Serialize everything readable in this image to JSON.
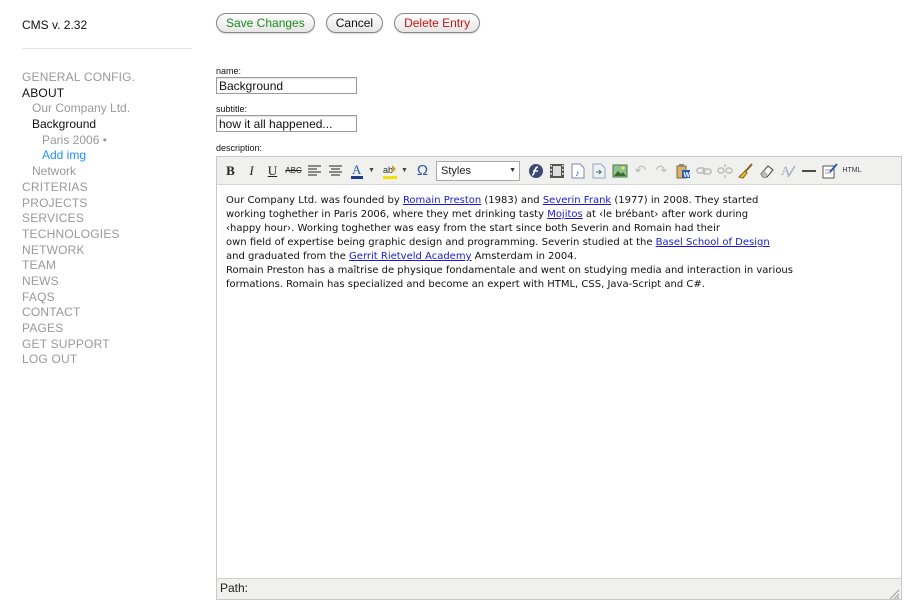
{
  "app": {
    "title": "CMS v. 2.32"
  },
  "nav": {
    "items": [
      {
        "label": "GENERAL CONFIG.",
        "level": 0,
        "active": false,
        "link": false
      },
      {
        "label": "ABOUT",
        "level": 0,
        "active": true,
        "link": false
      },
      {
        "label": "Our Company Ltd.",
        "level": 1,
        "active": false,
        "link": false
      },
      {
        "label": "Background",
        "level": 1,
        "active": true,
        "link": false
      },
      {
        "label": "Paris 2006 •",
        "level": 2,
        "active": false,
        "link": false
      },
      {
        "label": "Add img",
        "level": 2,
        "active": false,
        "link": true
      },
      {
        "label": "Network",
        "level": 1,
        "active": false,
        "link": false
      },
      {
        "label": "CRITERIAS",
        "level": 0,
        "active": false,
        "link": false
      },
      {
        "label": "PROJECTS",
        "level": 0,
        "active": false,
        "link": false
      },
      {
        "label": "SERVICES",
        "level": 0,
        "active": false,
        "link": false
      },
      {
        "label": "TECHNOLOGIES",
        "level": 0,
        "active": false,
        "link": false
      },
      {
        "label": "NETWORK",
        "level": 0,
        "active": false,
        "link": false
      },
      {
        "label": "TEAM",
        "level": 0,
        "active": false,
        "link": false
      },
      {
        "label": "NEWS",
        "level": 0,
        "active": false,
        "link": false
      },
      {
        "label": "FAQS",
        "level": 0,
        "active": false,
        "link": false
      },
      {
        "label": "CONTACT",
        "level": 0,
        "active": false,
        "link": false
      },
      {
        "label": "PAGES",
        "level": 0,
        "active": false,
        "link": false
      },
      {
        "label": "GET SUPPORT",
        "level": 0,
        "active": false,
        "link": false
      },
      {
        "label": "LOG OUT",
        "level": 0,
        "active": false,
        "link": false
      }
    ]
  },
  "actions": {
    "save_label": "Save Changes",
    "cancel_label": "Cancel",
    "delete_label": "Delete Entry"
  },
  "form": {
    "name_label": "name:",
    "name_value": "Background",
    "subtitle_label": "subtitle:",
    "subtitle_value": "how it all happened...",
    "description_label": "description:"
  },
  "editor": {
    "styles_label": "Styles",
    "toolbar_icons": [
      "bold-icon",
      "italic-icon",
      "underline-icon",
      "strikethrough-icon",
      "align-left-icon",
      "align-center-icon",
      "text-color-icon",
      "highlight-color-icon",
      "special-char-icon",
      "flash-icon",
      "film-icon",
      "music-file-icon",
      "insert-file-icon",
      "image-icon",
      "undo-icon",
      "redo-icon",
      "paste-word-icon",
      "link-icon",
      "unlink-icon",
      "cleanup-icon",
      "eraser-icon",
      "remove-format-icon",
      "horizontal-rule-icon",
      "edit-icon",
      "html-icon"
    ],
    "html_label": "HTML",
    "path_label": "Path:",
    "content": {
      "l1": {
        "t1": "Our Company Ltd. was founded by ",
        "a1": "Romain Preston",
        "t2": " (1983) and ",
        "a2": "Severin Frank",
        "t3": " (1977) in 2008. They started"
      },
      "l2": {
        "t1": "working toghether in Paris 2006, where they met drinking tasty ",
        "a1": "Mojitos",
        "t2": " at ‹le brébant› after work during"
      },
      "l3": {
        "t1": "‹happy hour›. Working toghether was easy from the start since both Severin and Romain had their"
      },
      "l4": {
        "t1": "own field of expertise being graphic design and programming. Severin studied at the ",
        "a1": "Basel School of Design"
      },
      "l5": {
        "t1": "and graduated from the ",
        "a1": "Gerrit Rietveld Academy",
        "t2": " Amsterdam in 2004."
      },
      "l6": {
        "t1": "Romain Preston has a maîtrise de physique fondamentale and went on studying media and interaction in various"
      },
      "l7": {
        "t1": "formations. Romain has specialized and become an expert with HTML, CSS, Java-Script and C#."
      }
    }
  },
  "colors": {
    "save": "#1a8a1a",
    "delete": "#d01010",
    "nav_link": "#1e90ff",
    "nav_inactive": "#999999",
    "hyperlink": "#1a1acc",
    "toolbar_bg": "#f0f0ee"
  }
}
